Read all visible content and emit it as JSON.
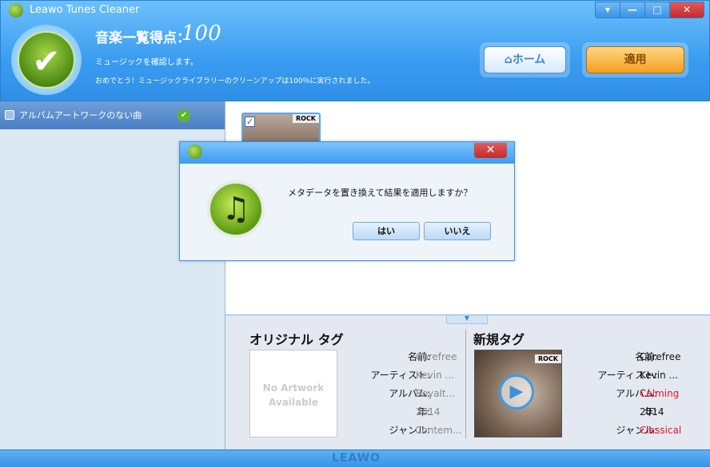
{
  "window": {
    "title": "Leawo Tunes Cleaner",
    "controls": [
      "menu",
      "minimize",
      "maximize",
      "close"
    ]
  },
  "header": {
    "score_label": "音楽一覧得点：",
    "score_value": "100",
    "message_1": "ミュージックを確認します。",
    "message_2": "おめでとう！ミュージックライブラリーのクリーンアップは100％に実行されました。",
    "home_label": "ホーム",
    "apply_label": "適用"
  },
  "sidebar": {
    "items": [
      {
        "label": "アルバムアートワークのない曲",
        "status": "complete"
      }
    ]
  },
  "main": {
    "thumb_tag": "ROCK"
  },
  "original": {
    "title": "オリジナル タグ",
    "no_artwork": "No Artwork Available",
    "rows": [
      {
        "key": "名前:",
        "value": "Carefree"
      },
      {
        "key": "アーティスト:",
        "value": "Kevin ..."
      },
      {
        "key": "アルバム:",
        "value": "Royalt..."
      },
      {
        "key": "年:",
        "value": "2014"
      },
      {
        "key": "ジャンル:",
        "value": "Contem..."
      }
    ]
  },
  "new": {
    "title": "新規タグ",
    "art_tag": "ROCK",
    "rows": [
      {
        "key": "名前:",
        "value": "Carefree",
        "changed": false
      },
      {
        "key": "アーティスト:",
        "value": "Kevin ...",
        "changed": false
      },
      {
        "key": "アルバム:",
        "value": "Calming",
        "changed": true
      },
      {
        "key": "年:",
        "value": "2014",
        "changed": false
      },
      {
        "key": "ジャンル:",
        "value": "Classical",
        "changed": true
      }
    ]
  },
  "footer": {
    "logo": "LEAWO"
  },
  "dialog": {
    "message": "メタデータを置き換えて結果を適用しますか？",
    "yes": "はい",
    "no": "いいえ"
  },
  "colors": {
    "accent": "#3a9cf0",
    "changed": "#e8102a",
    "original_value": "#888888",
    "apply": "#f3a020"
  }
}
